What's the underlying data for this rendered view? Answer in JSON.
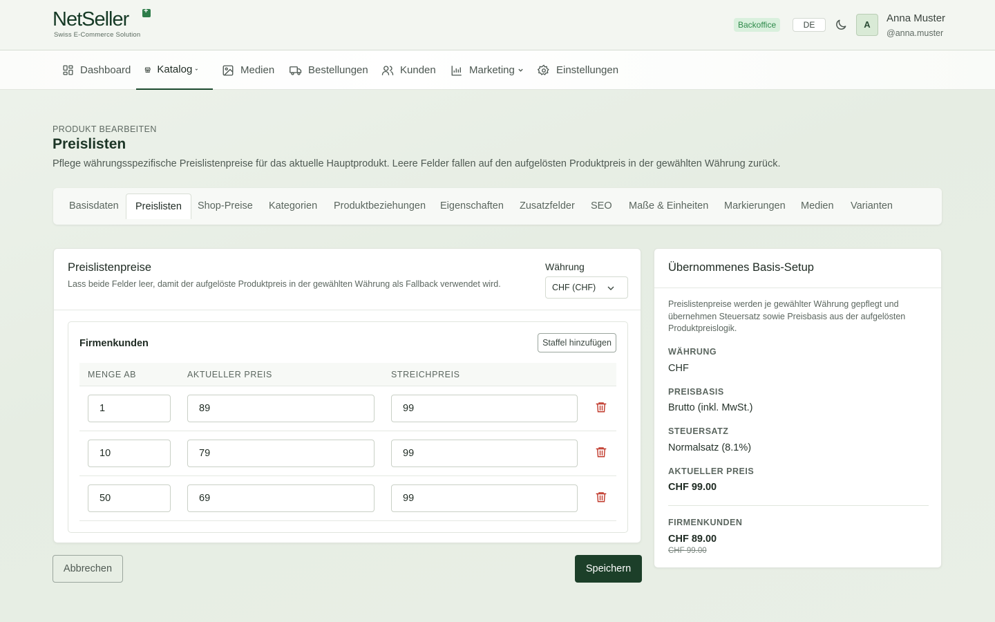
{
  "header": {
    "logo_word": "NetSeller",
    "logo_sub": "Swiss E-Commerce Solution",
    "badge": "Backoffice",
    "lang": "DE",
    "avatar_initial": "A",
    "user_name": "Anna Muster",
    "user_handle": "@anna.muster"
  },
  "nav": {
    "dashboard": "Dashboard",
    "katalog": "Katalog",
    "medien": "Medien",
    "bestellungen": "Bestellungen",
    "kunden": "Kunden",
    "marketing": "Marketing",
    "einstellungen": "Einstellungen"
  },
  "page": {
    "eyebrow": "PRODUKT BEARBEITEN",
    "title": "Preislisten",
    "description": "Pflege währungsspezifische Preislistenpreise für das aktuelle Hauptprodukt. Leere Felder fallen auf den aufgelösten Produktpreis in der gewählten Währung zurück."
  },
  "tabs": [
    "Basisdaten",
    "Preislisten",
    "Shop-Preise",
    "Kategorien",
    "Produktbeziehungen",
    "Eigenschaften",
    "Zusatzfelder",
    "SEO",
    "Maße & Einheiten",
    "Markierungen",
    "Medien",
    "Varianten"
  ],
  "main": {
    "title": "Preislistenpreise",
    "subtitle": "Lass beide Felder leer, damit der aufgelöste Produktpreis in der gewählten Währung als Fallback verwendet wird.",
    "currency_label": "Währung",
    "currency_value": "CHF (CHF)",
    "group_title": "Firmenkunden",
    "add_tier": "Staffel hinzufügen",
    "columns": [
      "MENGE AB",
      "AKTUELLER PREIS",
      "STREICHPREIS"
    ],
    "rows": [
      {
        "qty": "1",
        "price": "89",
        "strike": "99"
      },
      {
        "qty": "10",
        "price": "79",
        "strike": "99"
      },
      {
        "qty": "50",
        "price": "69",
        "strike": "99"
      }
    ],
    "cancel": "Abbrechen",
    "save": "Speichern"
  },
  "side": {
    "title": "Übernommenes Basis-Setup",
    "description": "Preislistenpreise werden je gewählter Währung gepflegt und übernehmen Steuersatz sowie Preisbasis aus der aufgelösten Produktpreislogik.",
    "waehrung_label": "WÄHRUNG",
    "waehrung_value": "CHF",
    "preisbasis_label": "PREISBASIS",
    "preisbasis_value": "Brutto (inkl. MwSt.)",
    "steuersatz_label": "STEUERSATZ",
    "steuersatz_value": "Normalsatz (8.1%)",
    "aktueller_label": "AKTUELLER PREIS",
    "aktueller_value": "CHF 99.00",
    "firmen_label": "FIRMENKUNDEN",
    "firmen_price": "CHF 89.00",
    "firmen_strike": "CHF 99.00"
  },
  "colors": {
    "brand": "#1c3f29",
    "accent_green": "#2e8a4a",
    "danger": "#c0392b"
  }
}
